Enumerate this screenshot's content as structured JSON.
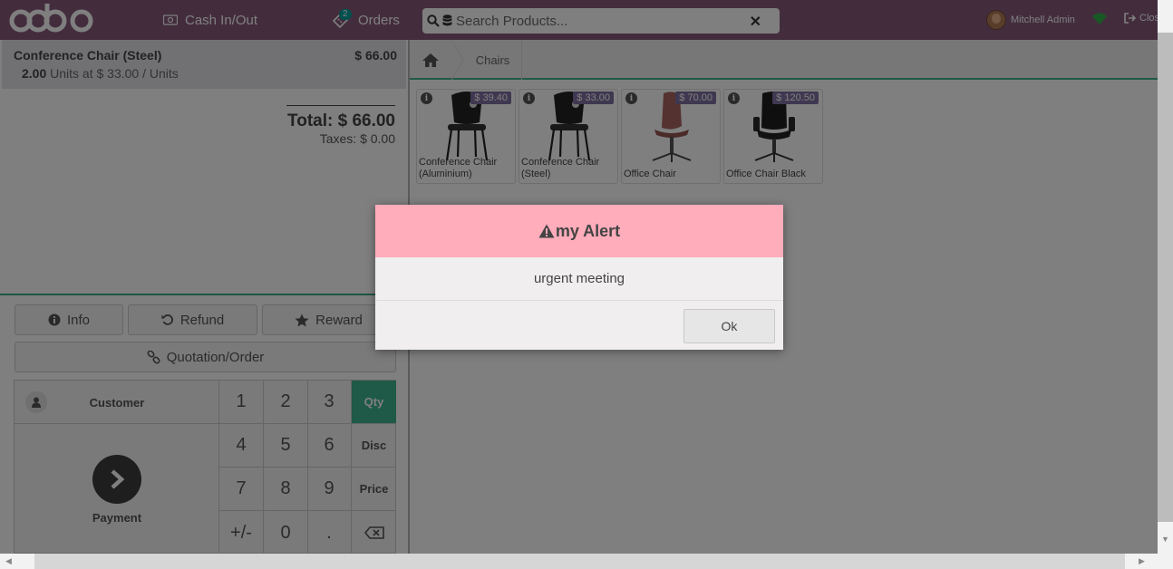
{
  "header": {
    "cash_label": "Cash In/Out",
    "orders_label": "Orders",
    "orders_count": "2",
    "search_placeholder": "Search Products...",
    "user_name": "Mitchell Admin",
    "close_label": "Close",
    "brand_color": "#875a7b"
  },
  "order": {
    "line": {
      "name": "Conference Chair (Steel)",
      "price": "$ 66.00",
      "qty": "2.00",
      "unit_text": "Units at $ 33.00 / Units"
    },
    "total": "Total: $ 66.00",
    "taxes": "Taxes: $ 0.00"
  },
  "controls": {
    "info": "Info",
    "refund": "Refund",
    "reward": "Reward",
    "quotation": "Quotation/Order"
  },
  "pad": {
    "customer": "Customer",
    "payment": "Payment",
    "keys": [
      "1",
      "2",
      "3",
      "4",
      "5",
      "6",
      "7",
      "8",
      "9",
      "+/-",
      "0",
      "."
    ],
    "modes": [
      "Qty",
      "Disc",
      "Price"
    ],
    "active_mode": "Qty",
    "active_color": "#3fb38f"
  },
  "breadcrumb": {
    "category": "Chairs"
  },
  "products": [
    {
      "name": "Conference Chair (Aluminium)",
      "price": "$ 39.40"
    },
    {
      "name": "Conference Chair (Steel)",
      "price": "$ 33.00"
    },
    {
      "name": "Office Chair",
      "price": "$ 70.00"
    },
    {
      "name": "Office Chair Black",
      "price": "$ 120.50"
    }
  ],
  "alert": {
    "title": "my Alert",
    "message": "urgent meeting",
    "ok": "Ok",
    "header_color": "#ffacbb"
  }
}
